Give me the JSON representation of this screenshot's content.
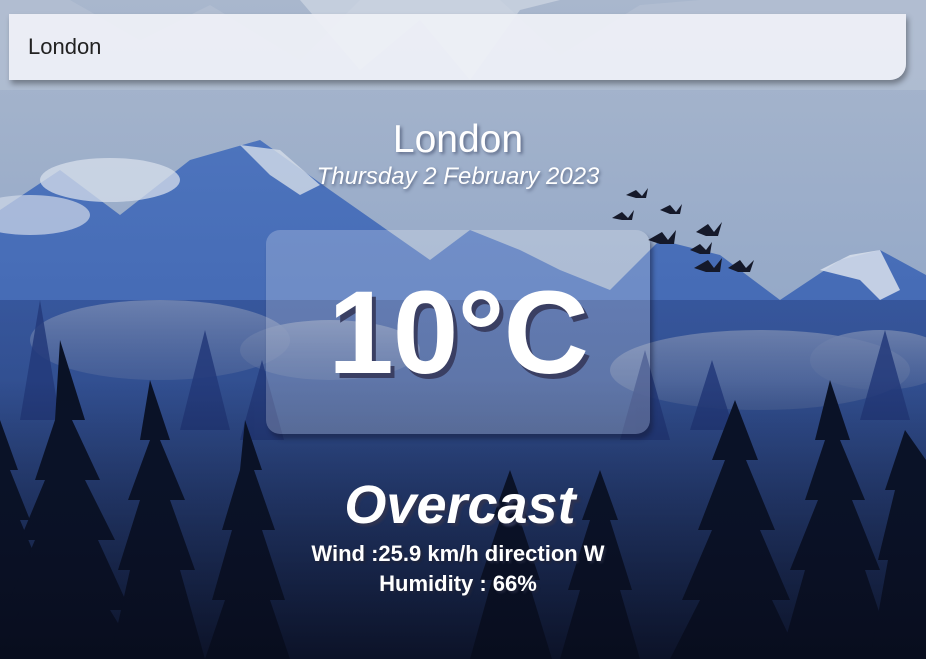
{
  "search": {
    "value": "London"
  },
  "weather": {
    "location": "London",
    "date": "Thursday 2 February 2023",
    "temperature": "10°C",
    "condition": "Overcast",
    "wind": "Wind :25.9 km/h direction W",
    "humidity": "Humidity : 66%"
  },
  "icons": {
    "background": "mountain-forest-landscape-illustration"
  },
  "colors": {
    "sky_top": "#9fb2cf",
    "mountain_blue": "#3e64b2",
    "forest_dark": "#0b1224",
    "text": "#ffffff"
  }
}
